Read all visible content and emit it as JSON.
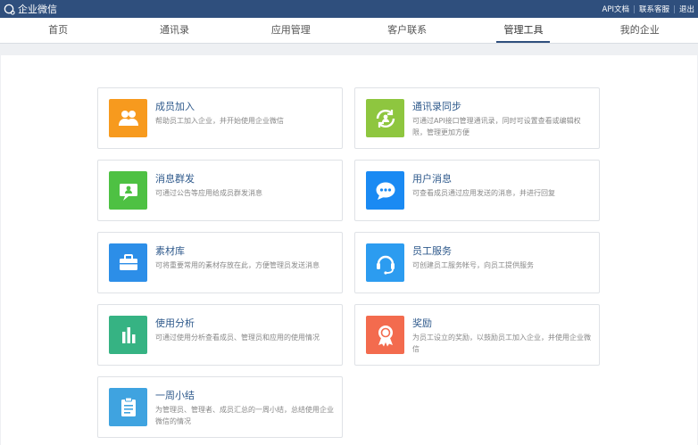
{
  "header": {
    "app_name": "企业微信",
    "links": [
      "API文档",
      "联系客服",
      "退出"
    ]
  },
  "nav": {
    "tabs": [
      "首页",
      "通讯录",
      "应用管理",
      "客户联系",
      "管理工具",
      "我的企业"
    ],
    "active": "管理工具"
  },
  "tools": [
    {
      "title": "成员加入",
      "desc": "帮助员工加入企业，并开始使用企业微信",
      "icon": "members-join-icon",
      "color": "#f79a1e"
    },
    {
      "title": "通讯录同步",
      "desc": "可通过API接口管理通讯录，同时可设置查看或编辑权限，管理更加方便",
      "icon": "contacts-sync-icon",
      "color": "#8ec63f"
    },
    {
      "title": "消息群发",
      "desc": "可通过公告等应用给成员群发消息",
      "icon": "broadcast-message-icon",
      "color": "#4ec143"
    },
    {
      "title": "用户消息",
      "desc": "可查看成员通过应用发送的消息，并进行回复",
      "icon": "chat-bubble-icon",
      "color": "#1a8af3"
    },
    {
      "title": "素材库",
      "desc": "可将重要常用的素材存放在此，方便管理员发送消息",
      "icon": "briefcase-icon",
      "color": "#2c8ee8"
    },
    {
      "title": "员工服务",
      "desc": "可创建员工服务帐号，向员工提供服务",
      "icon": "headset-icon",
      "color": "#2c9cf0"
    },
    {
      "title": "使用分析",
      "desc": "可通过使用分析查看成员、管理员和应用的使用情况",
      "icon": "bar-chart-icon",
      "color": "#36b383"
    },
    {
      "title": "奖励",
      "desc": "为员工设立的奖励，以鼓励员工加入企业，并使用企业微信",
      "icon": "award-icon",
      "color": "#f36b4e"
    },
    {
      "title": "一周小结",
      "desc": "为管理员、管理者、成员汇总的一周小结，总结使用企业微信的情况",
      "icon": "clipboard-icon",
      "color": "#3fa3e0"
    }
  ]
}
